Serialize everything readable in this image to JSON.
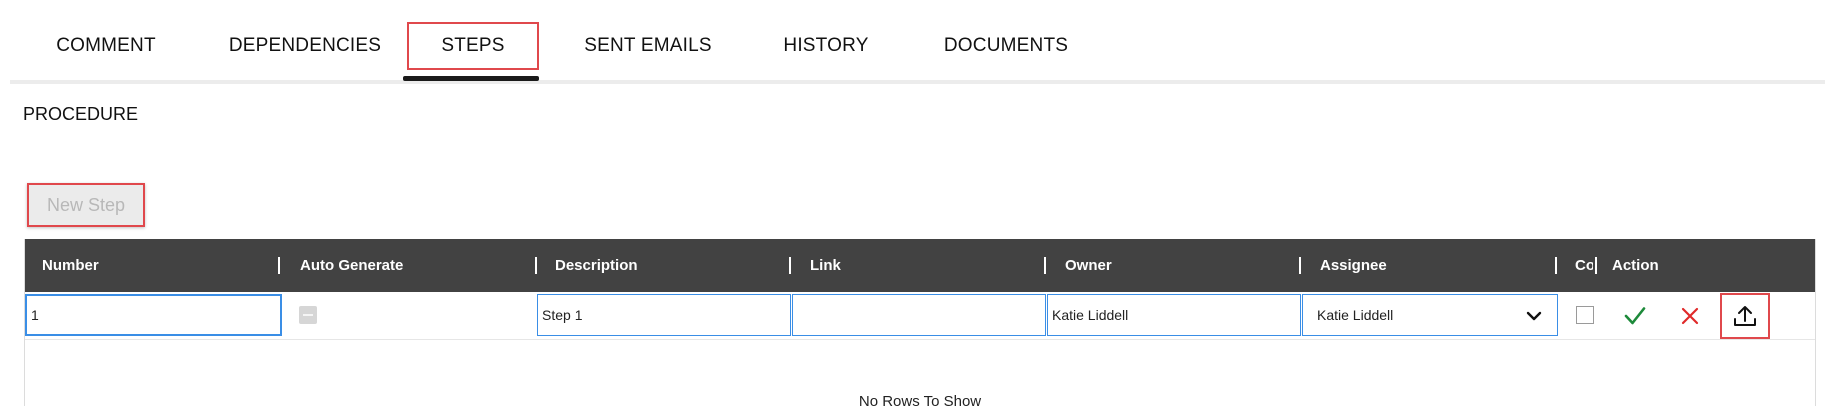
{
  "tabs": [
    {
      "label": "COMMENT"
    },
    {
      "label": "DEPENDENCIES"
    },
    {
      "label": "STEPS"
    },
    {
      "label": "SENT EMAILS"
    },
    {
      "label": "HISTORY"
    },
    {
      "label": "DOCUMENTS"
    }
  ],
  "active_tab": "STEPS",
  "section_title": "PROCEDURE",
  "new_step_label": "New Step",
  "grid": {
    "columns": [
      "Number",
      "Auto Generate",
      "Description",
      "Link",
      "Owner",
      "Assignee",
      "Co",
      "Action"
    ],
    "row": {
      "number": "1",
      "auto_generate": "indeterminate",
      "description": "Step 1",
      "link": "",
      "owner": "Katie Liddell",
      "assignee": "Katie Liddell",
      "completed": false
    },
    "empty_message": "No Rows To Show"
  },
  "icons": {
    "confirm": "check-icon",
    "cancel": "close-icon",
    "upload": "upload-icon",
    "dropdown": "chevron-down-icon"
  },
  "colors": {
    "highlight": "#e0484c",
    "header_bg": "#424242",
    "focus": "#3a8ee6",
    "confirm": "#1d8a3a",
    "cancel": "#e02a2a"
  }
}
